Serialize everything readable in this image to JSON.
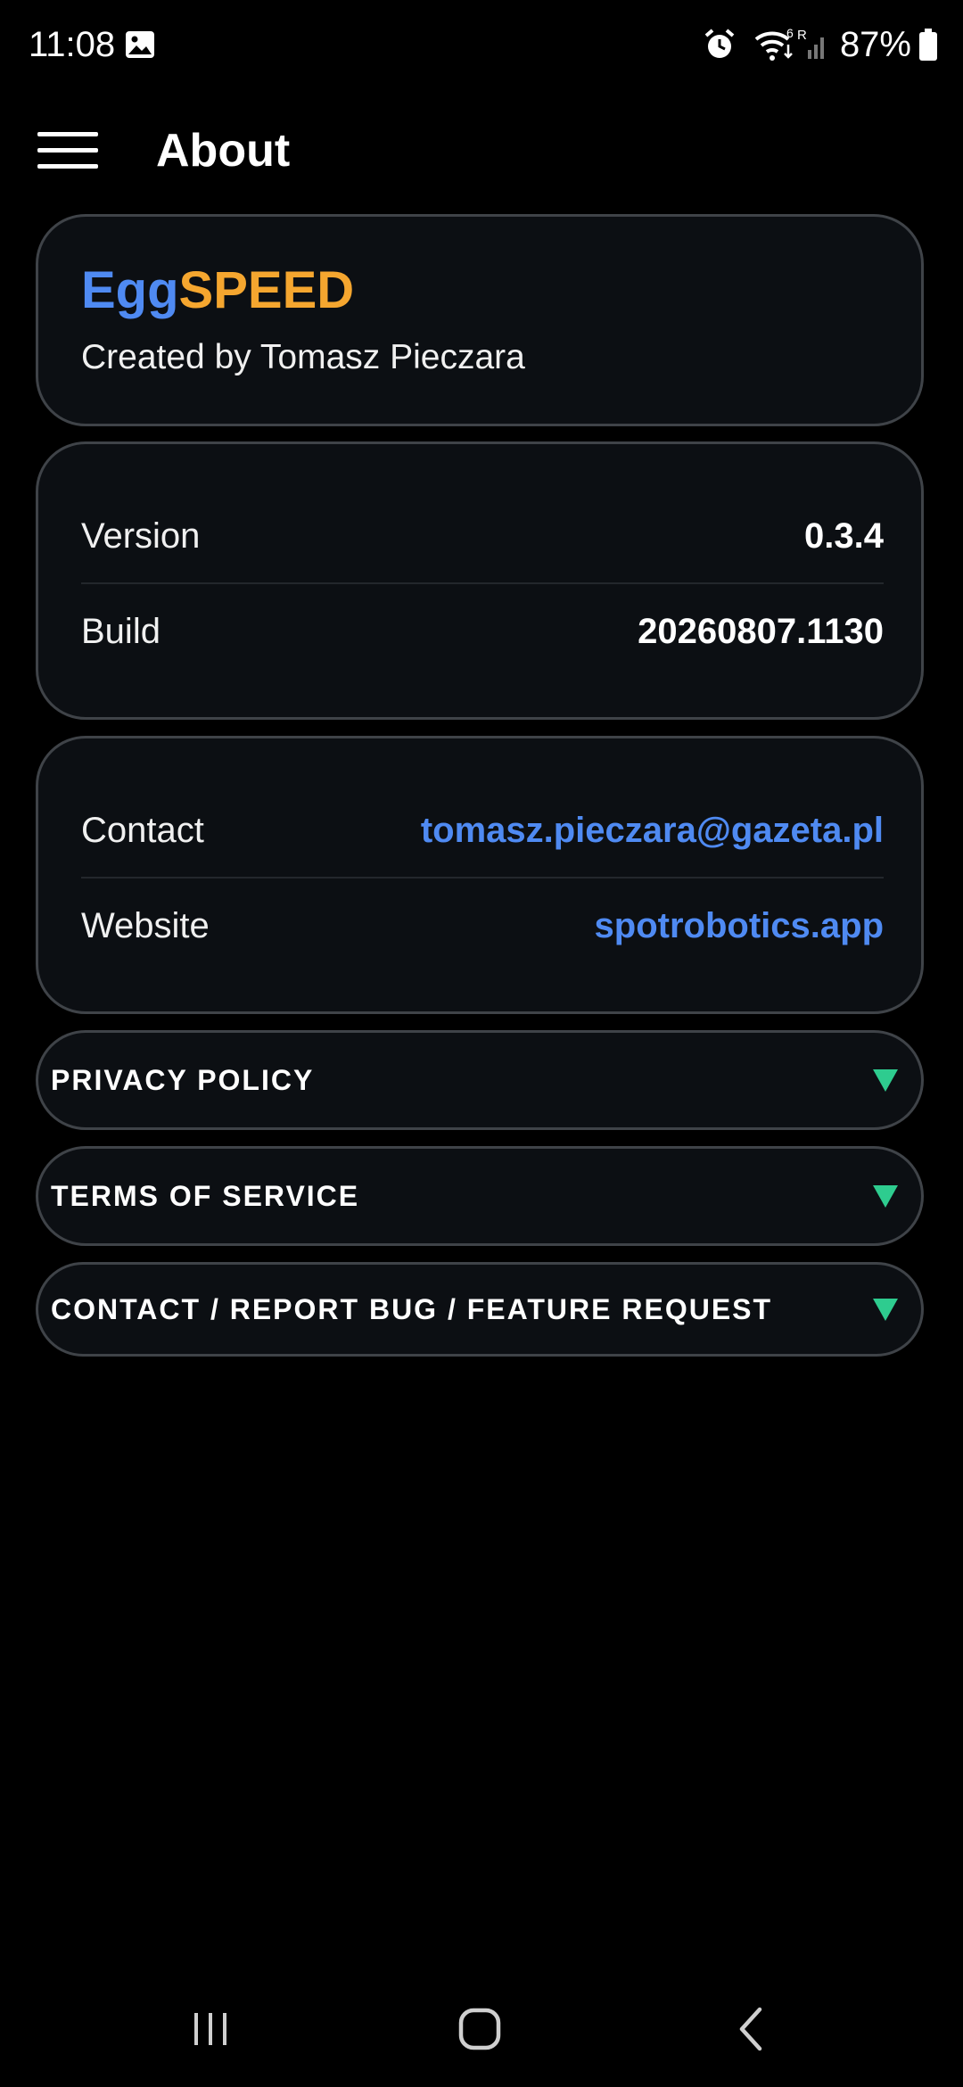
{
  "status_bar": {
    "time": "11:08",
    "battery": "87%",
    "network_badge": "R",
    "wifi_badge": "6"
  },
  "app_bar": {
    "title": "About"
  },
  "app_info": {
    "name_part_1": "Egg",
    "name_part_2": "SPEED",
    "creator": "Created by Tomasz Pieczara"
  },
  "details": {
    "version_label": "Version",
    "version_value": "0.3.4",
    "build_label": "Build",
    "build_value": "20260807.1130"
  },
  "contact": {
    "contact_label": "Contact",
    "contact_value": "tomasz.pieczara@gazeta.pl",
    "website_label": "Website",
    "website_value": "spotrobotics.app"
  },
  "sections": [
    {
      "label": "PRIVACY POLICY"
    },
    {
      "label": "TERMS OF SERVICE"
    },
    {
      "label": "CONTACT / REPORT BUG / FEATURE REQUEST"
    }
  ],
  "colors": {
    "accent_blue": "#4f8af2",
    "accent_orange": "#f5a62f",
    "arrow_green": "#2ecc8f",
    "card_bg": "#0c0f13",
    "card_border": "#3f4348"
  },
  "icons": {
    "menu": "hamburger-menu-icon",
    "expand": "triangle-down-icon",
    "nav_recents": "recents-icon",
    "nav_home": "home-icon",
    "nav_back": "back-icon"
  }
}
